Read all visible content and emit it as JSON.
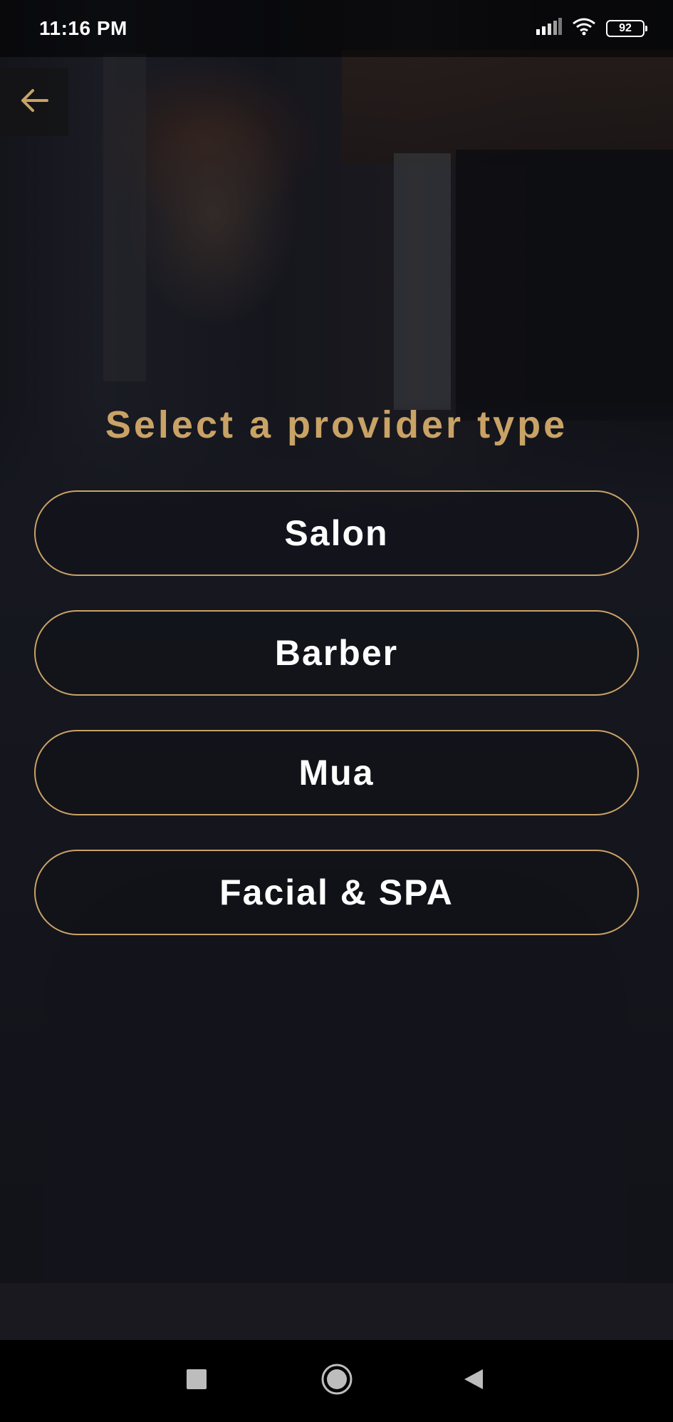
{
  "status_bar": {
    "time": "11:16 PM",
    "battery": "92"
  },
  "header": {
    "back_icon": "arrow-left-icon"
  },
  "main": {
    "title": "Select a provider type",
    "options": [
      {
        "label": "Salon"
      },
      {
        "label": "Barber"
      },
      {
        "label": "Mua"
      },
      {
        "label": "Facial & SPA"
      }
    ]
  },
  "nav_bar": {
    "recents_icon": "square-icon",
    "home_icon": "circle-icon",
    "back_icon": "triangle-back-icon"
  },
  "colors": {
    "accent": "#c9a266",
    "text": "#ffffff",
    "background": "#15161c"
  }
}
